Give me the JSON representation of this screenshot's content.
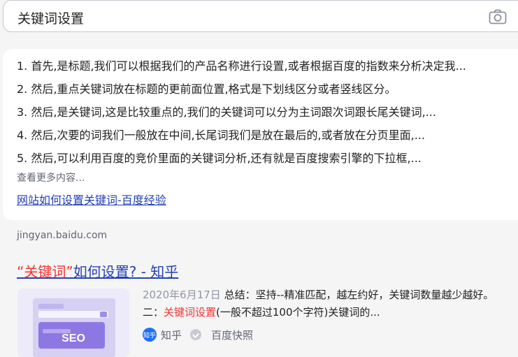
{
  "search": {
    "query": "关键词设置"
  },
  "answer": {
    "items": [
      "1. 首先,是标题,我们可以根据我们的产品名称进行设置,或者根据百度的指数来分析决定我...",
      "2. 然后,重点关键词放在标题的更前面位置,格式是下划线区分或者竖线区分。",
      "3. 然后,是关键词,这是比较重点的,我们的关键词可以分为主词跟次词跟长尾关键词,...",
      "4. 然后,次要的词我们一般放在中间,长尾词我们是放在最后的,或者放在分页里面,...",
      "5. 然后,可以利用百度的竞价里面的关键词分析,还有就是百度搜索引擎的下拉框,..."
    ],
    "more_label": "查看更多内容...",
    "link_text": "网站如何设置关键词-百度经验"
  },
  "source_domain": "jingyan.baidu.com",
  "result": {
    "title_highlight": "“关键词”",
    "title_rest": "如何设置? - 知乎",
    "date": "2020年6月17日",
    "snippet_part1": " 总结：坚持--精准匹配，越左约好，关键词数量越少越好。二：",
    "snippet_highlight": "关键词设置",
    "snippet_part2": "(一般不超过100个字符)关键词的...",
    "thumb_text": "SEO",
    "site_logo_text": "知乎",
    "site_name": "知乎",
    "cache_label": "百度快照"
  }
}
